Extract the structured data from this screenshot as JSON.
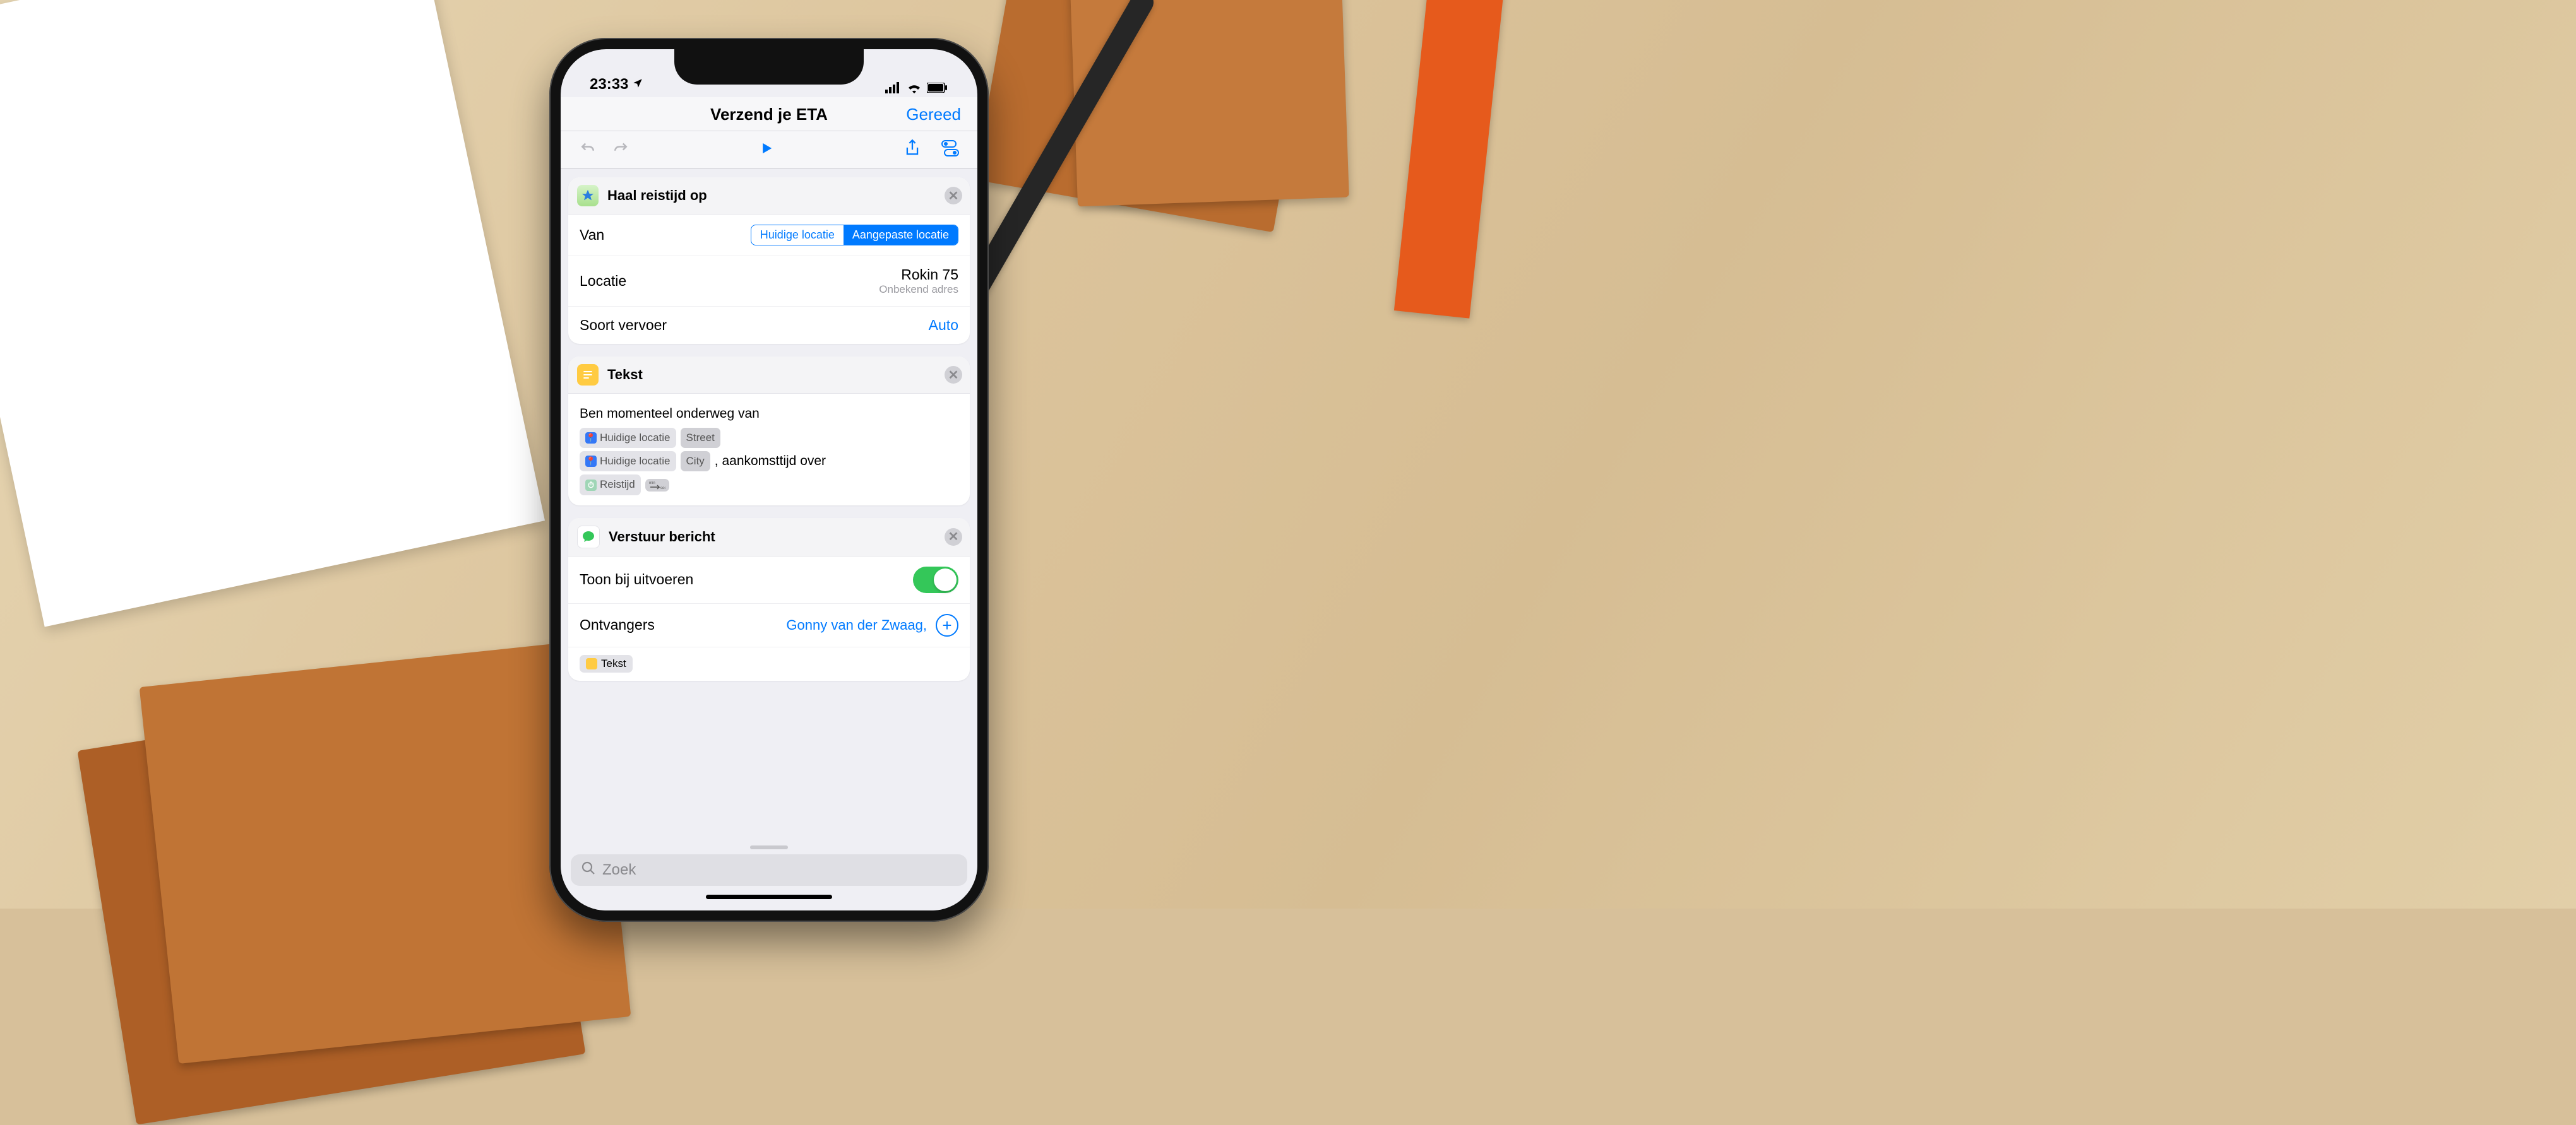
{
  "status": {
    "time": "23:33",
    "location_icon": "location-arrow"
  },
  "nav": {
    "title": "Verzend je ETA",
    "done": "Gereed"
  },
  "cards": {
    "travel": {
      "title": "Haal reistijd op",
      "from_label": "Van",
      "seg_current": "Huidige locatie",
      "seg_custom": "Aangepaste locatie",
      "location_label": "Locatie",
      "location_value": "Rokin 75",
      "location_sub": "Onbekend adres",
      "transport_label": "Soort vervoer",
      "transport_value": "Auto"
    },
    "text": {
      "title": "Tekst",
      "line1": "Ben momenteel onderweg van",
      "chip_loc": "Huidige locatie",
      "chip_street": "Street",
      "chip_city": "City",
      "middle": ", aankomsttijd over",
      "chip_travel": "Reistijd"
    },
    "message": {
      "title": "Verstuur bericht",
      "show_label": "Toon bij uitvoeren",
      "recipients_label": "Ontvangers",
      "recipient": "Gonny van der Zwaag,",
      "pill": "Tekst"
    }
  },
  "search": {
    "placeholder": "Zoek"
  }
}
